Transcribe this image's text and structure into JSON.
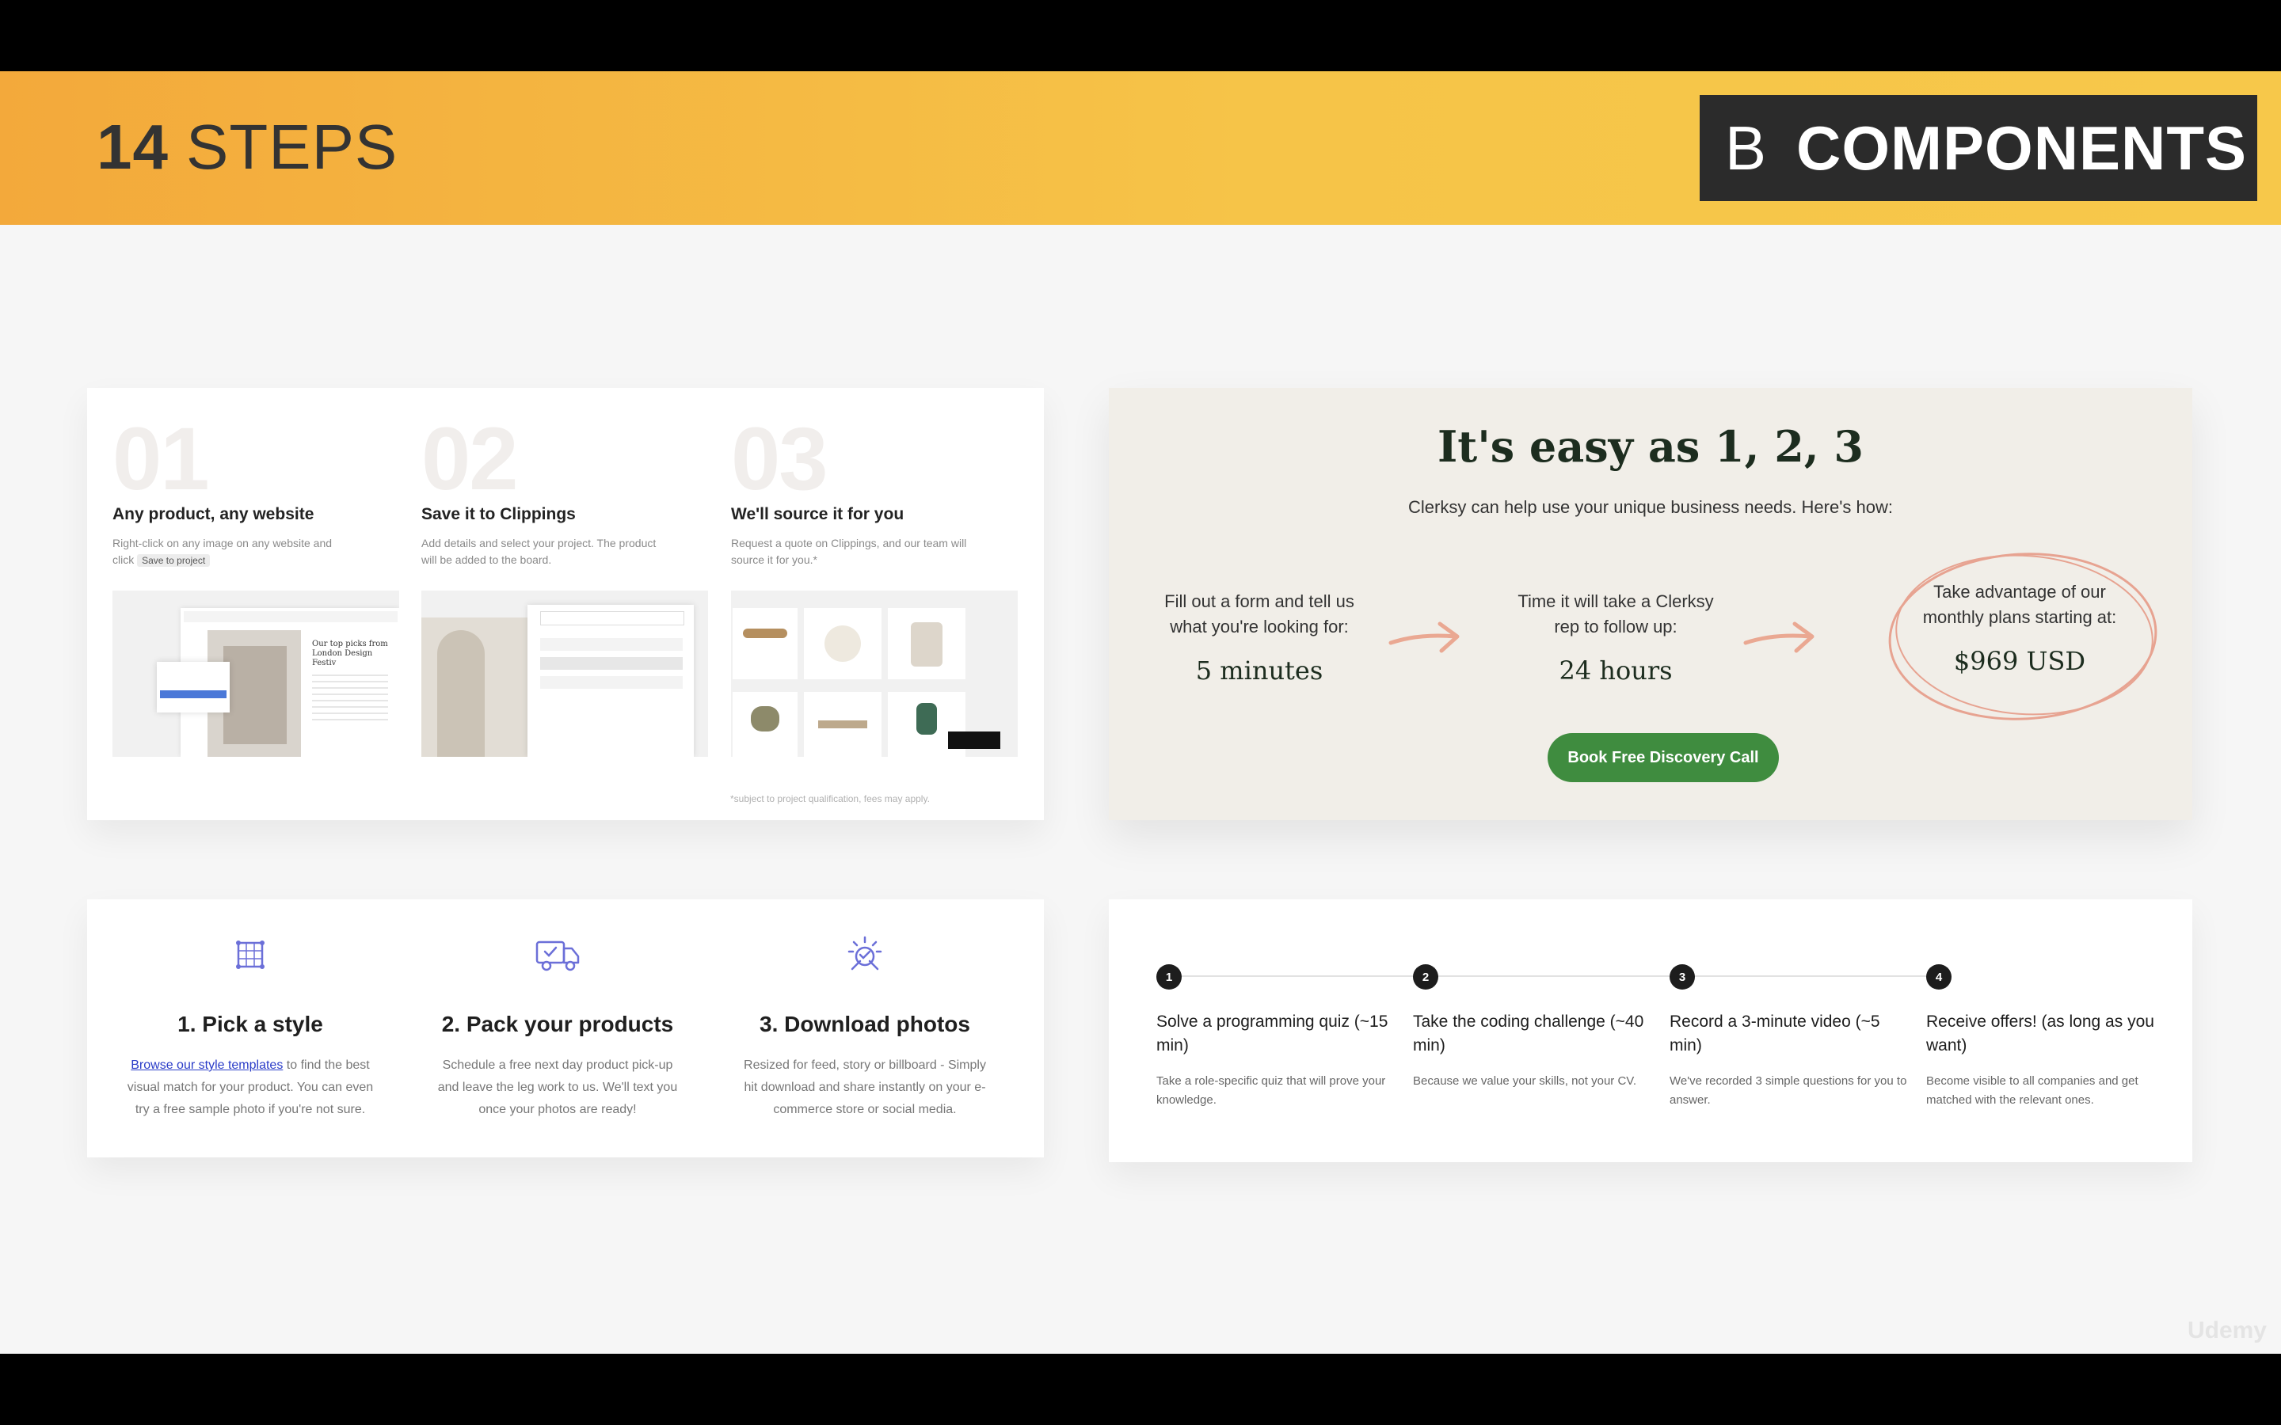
{
  "header": {
    "steps_number": "14",
    "steps_word": "STEPS",
    "badge_letter": "B",
    "badge_word": "COMPONENTS"
  },
  "card1": {
    "steps": [
      {
        "num": "01",
        "title": "Any product, any website",
        "desc": "Right-click on any image on any website and click ",
        "pill": "Save to project"
      },
      {
        "num": "02",
        "title": "Save it to Clippings",
        "desc": "Add details and select your project. The product will be added to the board.",
        "pill": ""
      },
      {
        "num": "03",
        "title": "We'll source it for you",
        "desc": "Request a quote on Clippings, and our team will source it for you.*",
        "pill": ""
      }
    ],
    "footnote": "*subject to project qualification, fees may apply.",
    "mock_text": "Our top picks from London Design Festiv"
  },
  "card2": {
    "title": "It's easy as 1, 2, 3",
    "subtitle": "Clerksy can help use your unique business needs. Here's how:",
    "steps": [
      {
        "text": "Fill out a form and tell us what you're looking for:",
        "value": "5 minutes"
      },
      {
        "text": "Time it will take a Clerksy rep to follow up:",
        "value": "24 hours"
      },
      {
        "text": "Take advantage of our monthly plans starting at:",
        "value": "$969 USD"
      }
    ],
    "button": "Book Free Discovery Call",
    "accent": "#e8a48c",
    "button_color": "#3f8c3f"
  },
  "card3": {
    "steps": [
      {
        "icon": "grid-frame-icon",
        "title": "1. Pick a style",
        "link": "Browse our style templates",
        "desc": " to find the best visual match for your product. You can even try a free sample photo if you're not sure."
      },
      {
        "icon": "delivery-truck-icon",
        "title": "2. Pack your products",
        "link": "",
        "desc": "Schedule a free next day product pick-up and leave the leg work to us. We'll text you once your photos are ready!"
      },
      {
        "icon": "camera-flash-icon",
        "title": "3. Download photos",
        "link": "",
        "desc": "Resized for feed, story or billboard - Simply hit download and share instantly on your e-commerce store or social media."
      }
    ],
    "icon_color": "#6b6fd8"
  },
  "card4": {
    "steps": [
      {
        "num": "1",
        "title": "Solve a programming quiz (~15 min)",
        "desc": "Take a role-specific quiz that will prove your knowledge."
      },
      {
        "num": "2",
        "title": "Take the coding challenge (~40 min)",
        "desc": "Because we value your skills, not your CV."
      },
      {
        "num": "3",
        "title": "Record a 3-minute video (~5 min)",
        "desc": "We've recorded 3 simple questions for you to answer."
      },
      {
        "num": "4",
        "title": "Receive offers! (as long as you want)",
        "desc": "Become visible to all companies and get matched with the relevant ones."
      }
    ]
  },
  "watermark": "Udemy"
}
